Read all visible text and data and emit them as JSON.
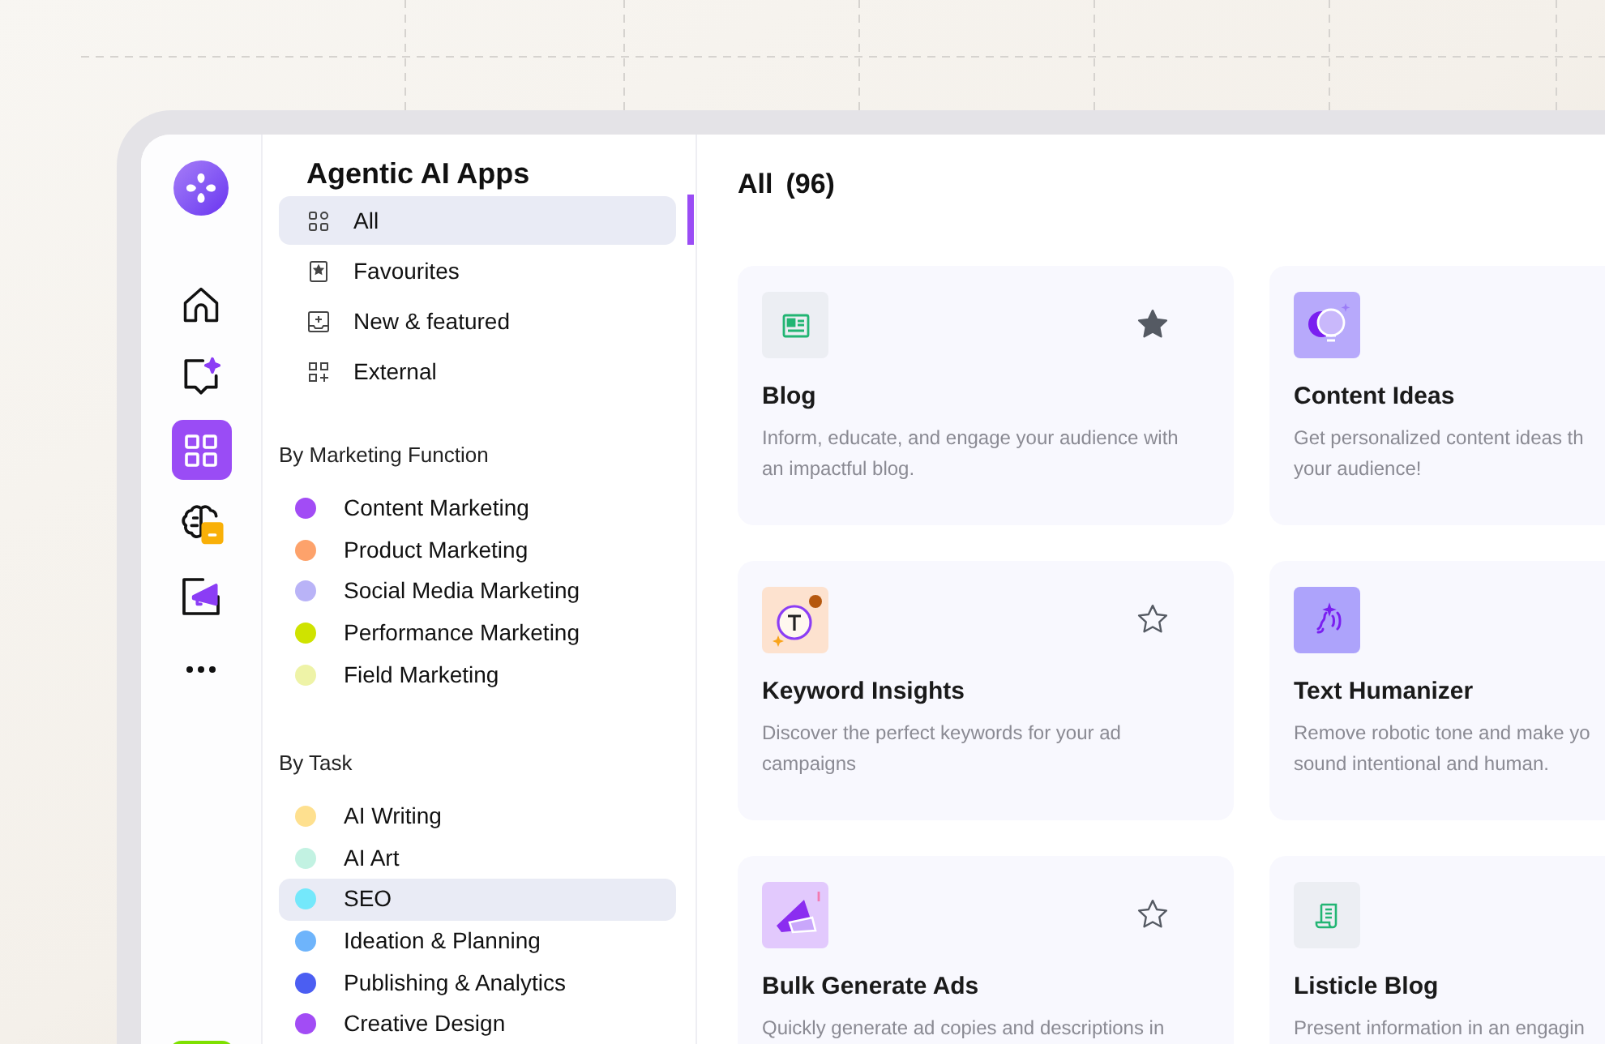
{
  "app_title": "Agentic AI Apps",
  "nav": [
    {
      "label": "All",
      "selected": true
    },
    {
      "label": "Favourites",
      "selected": false
    },
    {
      "label": "New & featured",
      "selected": false
    },
    {
      "label": "External",
      "selected": false
    }
  ],
  "groups": [
    {
      "heading": "By Marketing Function",
      "items": [
        {
          "label": "Content Marketing",
          "color": "#a24cf5",
          "selected": false
        },
        {
          "label": "Product Marketing",
          "color": "#fda26b",
          "selected": false
        },
        {
          "label": "Social Media Marketing",
          "color": "#b9b3f7",
          "selected": false
        },
        {
          "label": "Performance Marketing",
          "color": "#cfe300",
          "selected": false
        },
        {
          "label": "Field Marketing",
          "color": "#eef3a7",
          "selected": false
        }
      ]
    },
    {
      "heading": "By Task",
      "items": [
        {
          "label": "AI Writing",
          "color": "#fee08f",
          "selected": false
        },
        {
          "label": "AI Art",
          "color": "#c2f2e2",
          "selected": false
        },
        {
          "label": "SEO",
          "color": "#74e8fb",
          "selected": true
        },
        {
          "label": "Ideation & Planning",
          "color": "#6eb4fb",
          "selected": false
        },
        {
          "label": "Publishing & Analytics",
          "color": "#4b5ef2",
          "selected": false
        },
        {
          "label": "Creative Design",
          "color": "#a24cf5",
          "selected": false
        }
      ]
    }
  ],
  "rail": [
    {
      "selected": false
    },
    {
      "selected": false
    },
    {
      "selected": true
    },
    {
      "selected": false
    },
    {
      "selected": false
    },
    {
      "selected": false
    }
  ],
  "main": {
    "heading": "All",
    "count": "(96)"
  },
  "cards": [
    {
      "title": "Blog",
      "description": "Inform, educate, and engage your audience with an impactful blog.",
      "favourite": true
    },
    {
      "title": "Content Ideas",
      "description": "Get personalized content ideas th\nyour audience!"
    },
    {
      "title": "Keyword Insights",
      "description": "Discover the perfect keywords for your ad campaigns",
      "favourite": false
    },
    {
      "title": "Text Humanizer",
      "description": "Remove robotic tone and make yo\nsound intentional and human."
    },
    {
      "title": "Bulk Generate Ads",
      "description": "Quickly generate ad copies and descriptions in",
      "favourite": false
    },
    {
      "title": "Listicle Blog",
      "description": "Present information in an engagin"
    }
  ]
}
